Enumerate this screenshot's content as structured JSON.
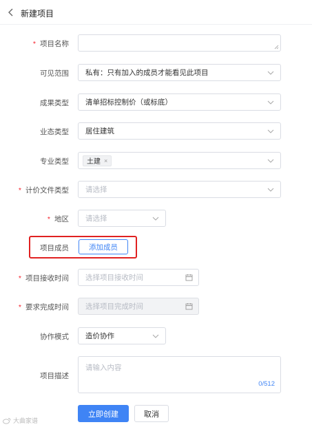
{
  "header": {
    "title": "新建项目"
  },
  "form": {
    "project_name": {
      "label": "项目名称",
      "required": true,
      "value": ""
    },
    "visibility": {
      "label": "可见范围",
      "value": "私有：只有加入的成员才能看见此项目"
    },
    "result_type": {
      "label": "成果类型",
      "value": "清单招标控制价（或标底）"
    },
    "business_type": {
      "label": "业态类型",
      "value": "居住建筑"
    },
    "specialty_type": {
      "label": "专业类型",
      "tags": [
        "土建"
      ],
      "tag_remove": "×"
    },
    "pricing_file_type": {
      "label": "计价文件类型",
      "required": true,
      "placeholder": "请选择"
    },
    "region": {
      "label": "地区",
      "required": true,
      "placeholder": "请选择"
    },
    "members": {
      "label": "项目成员",
      "add_button": "添加成员"
    },
    "receive_time": {
      "label": "项目接收时间",
      "required": true,
      "placeholder": "选择项目接收时间"
    },
    "deadline": {
      "label": "要求完成时间",
      "required": true,
      "placeholder": "选择项目完成时间"
    },
    "collab_mode": {
      "label": "协作模式",
      "value": "造价协作"
    },
    "description": {
      "label": "项目描述",
      "placeholder": "请输入内容",
      "counter": "0/512"
    }
  },
  "actions": {
    "submit": "立即创建",
    "cancel": "取消"
  },
  "required_mark": "*",
  "watermark": "大曲家谱",
  "colors": {
    "primary": "#3f84f5",
    "required": "#f5222d",
    "highlight": "#e02020"
  }
}
